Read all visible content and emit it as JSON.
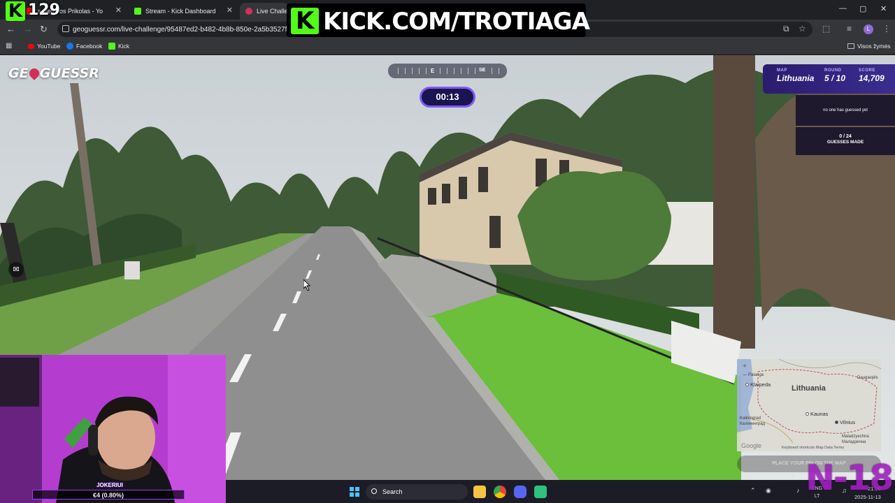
{
  "overlay": {
    "viewer_count": "129",
    "banner_text": "KICK.COM/TROTIAGA",
    "age_tag": "N-18",
    "kick_color": "#53fc18"
  },
  "browser": {
    "tabs": [
      {
        "title": "s Lietuvos Prikolas - Yo",
        "icon": "youtube-icon"
      },
      {
        "title": "Stream - Kick Dashboard",
        "icon": "kick-icon"
      },
      {
        "title": "Live Challeng",
        "icon": "geoguessr-icon"
      }
    ],
    "url": "geoguessr.com/live-challenge/95487ed2-b482-4b8b-850e-2a5b3527fe93",
    "bookmarks": [
      {
        "label": "YouTube",
        "icon": "youtube-icon"
      },
      {
        "label": "Facebook",
        "icon": "facebook-icon"
      },
      {
        "label": "Kick",
        "icon": "kick-icon"
      }
    ],
    "all_bookmarks_label": "Visos žymės",
    "profile_initial": "L"
  },
  "game": {
    "logo": {
      "left": "GE",
      "right": "GUESSR"
    },
    "compass": {
      "e": "E",
      "se": "SE"
    },
    "timer": "00:13",
    "status": {
      "map_label": "MAP",
      "map_value": "Lithuania",
      "round_label": "ROUND",
      "round_value": "5 / 10",
      "score_label": "SCORE",
      "score_value": "14,709"
    },
    "guess_status": "no one has guessed yet",
    "guesses_count": "0 / 24",
    "guesses_label": "GUESSES MADE",
    "place_pin": "PLACE YOUR PIN ON THE MAP",
    "minimap": {
      "title": "Lithuania",
      "cities": [
        "Klaipeda",
        "Kaunas",
        "Vilnius",
        "Palanga",
        "Kaliningrad",
        "Калининград",
        "Maladzyechna",
        "Маладзечна",
        "Daugavpils"
      ],
      "legal": "Keyboard shortcuts   Map Data   Terms",
      "footer": "Keyboard shortcuts  Map data ©2025 Google",
      "google": "Google"
    }
  },
  "webcam": {
    "name": "JOKERIUI",
    "stat": "€4 (0.80%)"
  },
  "taskbar": {
    "search_label": "Search",
    "lang_top": "ENG",
    "lang_bottom": "LT",
    "time": "21:06",
    "date": "2025-11-13"
  }
}
